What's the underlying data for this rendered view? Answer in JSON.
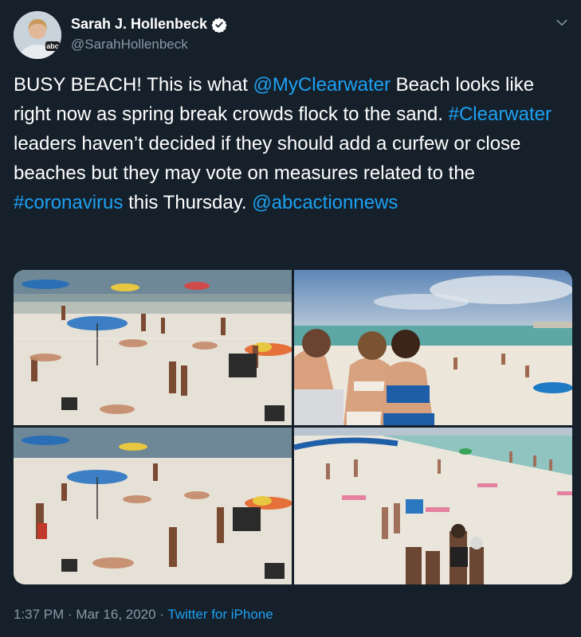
{
  "author": {
    "display_name": "Sarah J. Hollenbeck",
    "handle": "@SarahHollenbeck",
    "avatar_badge": "abc"
  },
  "tweet": {
    "parts": [
      {
        "text": "BUSY BEACH! This is what ",
        "link": false
      },
      {
        "text": "@MyClearwater",
        "link": true
      },
      {
        "text": " Beach looks like right now as spring break crowds flock to the sand. ",
        "link": false
      },
      {
        "text": "#Clearwater",
        "link": true
      },
      {
        "text": " leaders haven’t decided if they should add a curfew or close beaches but they may vote on measures related to the ",
        "link": false
      },
      {
        "text": "#coronavirus",
        "link": true
      },
      {
        "text": " this Thursday. ",
        "link": false
      },
      {
        "text": "@abcactionnews",
        "link": true
      }
    ]
  },
  "meta": {
    "time": "1:37 PM",
    "sep1": " · ",
    "date": "Mar 16, 2020",
    "sep2": " · ",
    "source": "Twitter for iPhone"
  },
  "colors": {
    "background": "#15202b",
    "link": "#1da1f2",
    "secondary_text": "#8899a6"
  },
  "icons": [
    "verified-badge-icon",
    "chevron-down-icon"
  ]
}
